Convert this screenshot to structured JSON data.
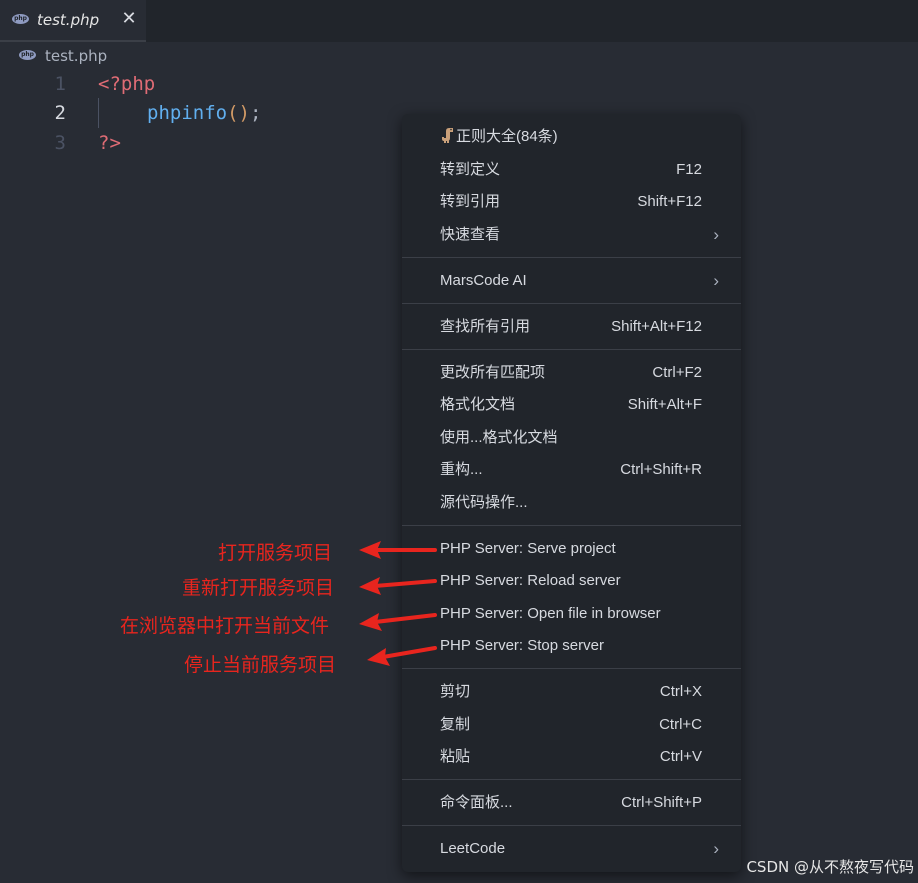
{
  "tab": {
    "filename": "test.php",
    "close_glyph": "✕",
    "icon": "php-file-icon"
  },
  "breadcrumb": {
    "filename": "test.php"
  },
  "editor": {
    "lines": [
      {
        "number": "1",
        "open_tag": "<?php"
      },
      {
        "number": "2",
        "function": "phpinfo",
        "paren": "()",
        "semicolon": ";"
      },
      {
        "number": "3",
        "close_tag": "?>"
      }
    ]
  },
  "context_menu": {
    "regex_label": "正则大全(84条)",
    "go_to_definition": {
      "label": "转到定义",
      "shortcut": "F12"
    },
    "go_to_references": {
      "label": "转到引用",
      "shortcut": "Shift+F12"
    },
    "peek": {
      "label": "快速查看"
    },
    "marscode": {
      "label": "MarsCode AI"
    },
    "find_all_references": {
      "label": "查找所有引用",
      "shortcut": "Shift+Alt+F12"
    },
    "change_all_occurrences": {
      "label": "更改所有匹配项",
      "shortcut": "Ctrl+F2"
    },
    "format_document": {
      "label": "格式化文档",
      "shortcut": "Shift+Alt+F"
    },
    "format_document_with": {
      "label": "使用...格式化文档"
    },
    "refactor": {
      "label": "重构...",
      "shortcut": "Ctrl+Shift+R"
    },
    "source_action": {
      "label": "源代码操作..."
    },
    "php_serve": {
      "label": "PHP Server: Serve project"
    },
    "php_reload": {
      "label": "PHP Server: Reload server"
    },
    "php_open": {
      "label": "PHP Server: Open file in browser"
    },
    "php_stop": {
      "label": "PHP Server: Stop server"
    },
    "cut": {
      "label": "剪切",
      "shortcut": "Ctrl+X"
    },
    "copy": {
      "label": "复制",
      "shortcut": "Ctrl+C"
    },
    "paste": {
      "label": "粘贴",
      "shortcut": "Ctrl+V"
    },
    "command_palette": {
      "label": "命令面板...",
      "shortcut": "Ctrl+Shift+P"
    },
    "leetcode": {
      "label": "LeetCode"
    },
    "submenu_glyph": "›"
  },
  "annotations": {
    "serve": "打开服务项目",
    "reload": "重新打开服务项目",
    "open": "在浏览器中打开当前文件",
    "stop": "停止当前服务项目"
  },
  "watermark": "CSDN @从不熬夜写代码",
  "colors": {
    "editor_bg": "#282c34",
    "menu_bg": "#21252b",
    "annotation_red": "#e8251e",
    "php_tag": "#e06c75",
    "function": "#61afef"
  }
}
